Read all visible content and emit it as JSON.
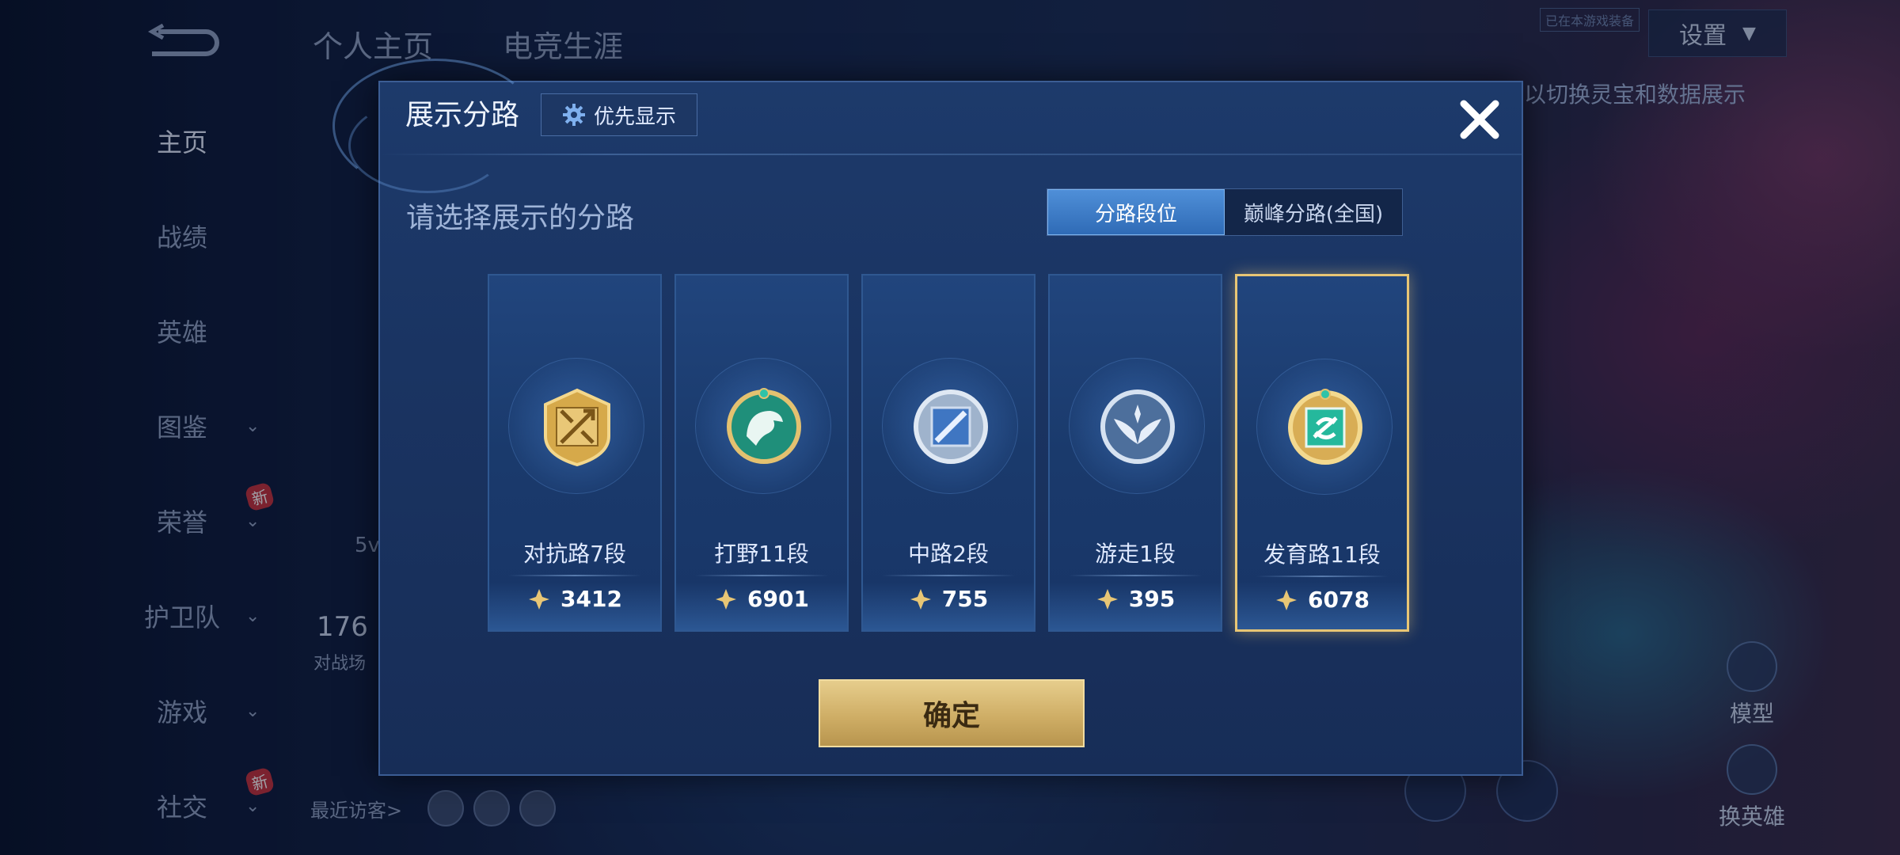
{
  "top_tabs": [
    "个人主页",
    "电竞生涯"
  ],
  "sidebar": {
    "items": [
      {
        "label": "主页",
        "active": true,
        "chevron": false,
        "new": false
      },
      {
        "label": "战绩",
        "active": false,
        "chevron": false,
        "new": false
      },
      {
        "label": "英雄",
        "active": false,
        "chevron": false,
        "new": false
      },
      {
        "label": "图鉴",
        "active": false,
        "chevron": true,
        "new": false
      },
      {
        "label": "荣誉",
        "active": false,
        "chevron": true,
        "new": true
      },
      {
        "label": "护卫队",
        "active": false,
        "chevron": true,
        "new": false
      },
      {
        "label": "游戏",
        "active": false,
        "chevron": true,
        "new": false
      },
      {
        "label": "社交",
        "active": false,
        "chevron": true,
        "new": true
      }
    ],
    "new_badge": "新"
  },
  "settings_label": "设置",
  "background_hint": "以切换灵宝和数据展示",
  "small_tag": "已在本游戏装备",
  "left_stats": {
    "value": "176",
    "label": "对战场",
    "sub": "5v"
  },
  "recent_visitors": "最近访客>",
  "right_buttons": [
    "模型",
    "换英雄"
  ],
  "modal": {
    "title": "展示分路",
    "priority_label": "优先显示",
    "subtitle": "请选择展示的分路",
    "segment": {
      "options": [
        "分路段位",
        "巅峰分路(全国)"
      ],
      "active_index": 0
    },
    "cards": [
      {
        "label": "对抗路7段",
        "score": "3412",
        "emblem": "sword-emblem-icon",
        "selected": false
      },
      {
        "label": "打野11段",
        "score": "6901",
        "emblem": "dragon-emblem-icon",
        "selected": false
      },
      {
        "label": "中路2段",
        "score": "755",
        "emblem": "slash-emblem-icon",
        "selected": false
      },
      {
        "label": "游走1段",
        "score": "395",
        "emblem": "wings-emblem-icon",
        "selected": false
      },
      {
        "label": "发育路11段",
        "score": "6078",
        "emblem": "arrow-emblem-icon",
        "selected": true
      }
    ],
    "confirm_label": "确定"
  },
  "colors": {
    "accent_gold": "#e8c675",
    "active_blue": "#4f8fd8",
    "modal_bg": "#1d3a6b"
  }
}
